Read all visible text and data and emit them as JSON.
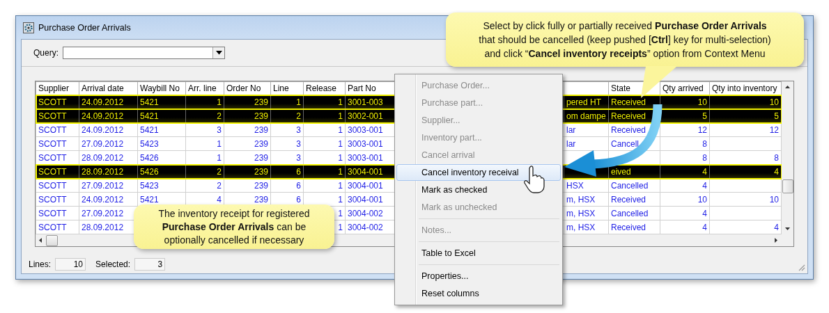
{
  "window": {
    "title": "Purchase Order Arrivals"
  },
  "query": {
    "label": "Query:"
  },
  "table": {
    "columns": [
      "Supplier",
      "Arrival date",
      "Waybill No",
      "Arr. line",
      "Order No",
      "Line",
      "Release",
      "Part No",
      "State",
      "Qty arrived",
      "Qty into inventory"
    ],
    "rows": [
      {
        "supplier": "SCOTT",
        "arrival_date": "24.09.2012",
        "waybill_no": "5421",
        "arr_line": "1",
        "order_no": "239",
        "line": "1",
        "release": "1",
        "part_no": "3001-003",
        "column_9": "pered HT",
        "state": "Received",
        "qty_arrived": "10",
        "qty_into_inventory": "10",
        "selected": true
      },
      {
        "supplier": "SCOTT",
        "arrival_date": "24.09.2012",
        "waybill_no": "5421",
        "arr_line": "2",
        "order_no": "239",
        "line": "2",
        "release": "1",
        "part_no": "3002-001",
        "column_9": "om dampe",
        "state": "Received",
        "qty_arrived": "5",
        "qty_into_inventory": "5",
        "selected": true
      },
      {
        "supplier": "SCOTT",
        "arrival_date": "24.09.2012",
        "waybill_no": "5421",
        "arr_line": "3",
        "order_no": "239",
        "line": "3",
        "release": "1",
        "part_no": "3003-001",
        "column_9": "lar",
        "state": "Received",
        "qty_arrived": "12",
        "qty_into_inventory": "12",
        "selected": false
      },
      {
        "supplier": "SCOTT",
        "arrival_date": "27.09.2012",
        "waybill_no": "5423",
        "arr_line": "1",
        "order_no": "239",
        "line": "3",
        "release": "1",
        "part_no": "3003-001",
        "column_9": "lar",
        "state": "Cancell",
        "qty_arrived": "8",
        "selected": false
      },
      {
        "supplier": "SCOTT",
        "arrival_date": "28.09.2012",
        "waybill_no": "5426",
        "arr_line": "1",
        "order_no": "239",
        "line": "3",
        "release": "1",
        "part_no": "3003-001",
        "qty_arrived": "8",
        "qty_into_inventory": "8",
        "selected": false
      },
      {
        "supplier": "SCOTT",
        "arrival_date": "28.09.2012",
        "waybill_no": "5426",
        "arr_line": "2",
        "order_no": "239",
        "line": "6",
        "release": "1",
        "part_no": "3004-001",
        "state": "eived",
        "qty_arrived": "4",
        "qty_into_inventory": "4",
        "selected": true
      },
      {
        "supplier": "SCOTT",
        "arrival_date": "27.09.2012",
        "waybill_no": "5423",
        "arr_line": "2",
        "order_no": "239",
        "line": "6",
        "release": "1",
        "part_no": "3004-001",
        "column_9": "HSX",
        "state": "Cancelled",
        "qty_arrived": "4",
        "selected": false
      },
      {
        "supplier": "SCOTT",
        "arrival_date": "24.09.2012",
        "waybill_no": "5421",
        "arr_line": "4",
        "order_no": "239",
        "line": "6",
        "release": "1",
        "part_no": "3004-001",
        "column_9": "m, HSX",
        "state": "Received",
        "qty_arrived": "10",
        "qty_into_inventory": "10",
        "selected": false
      },
      {
        "supplier": "SCOTT",
        "arrival_date": "27.09.2012",
        "release": "1",
        "part_no": "3004-002",
        "column_9": "m, HSX",
        "state": "Cancelled",
        "qty_arrived": "4",
        "selected": false
      },
      {
        "supplier": "SCOTT",
        "arrival_date": "28.09.2012",
        "release": "1",
        "part_no": "3004-002",
        "column_9": "m, HSX",
        "state": "Received",
        "qty_arrived": "4",
        "qty_into_inventory": "4",
        "selected": false
      }
    ]
  },
  "status_bar": {
    "lines_label": "Lines:",
    "lines": "10",
    "selected_label": "Selected:",
    "selected_count": "3"
  },
  "context_menu": [
    {
      "kind": "item",
      "label": "Purchase Order...",
      "disabled": true,
      "selected": false
    },
    {
      "kind": "item",
      "label": "Purchase part...",
      "disabled": true,
      "selected": false
    },
    {
      "kind": "item",
      "label": "Supplier...",
      "disabled": true,
      "selected": false
    },
    {
      "kind": "item",
      "label": "Inventory part...",
      "disabled": true,
      "selected": false
    },
    {
      "kind": "item",
      "label": "Cancel arrival",
      "disabled": true,
      "selected": false
    },
    {
      "kind": "item",
      "label": "Cancel inventory receival",
      "disabled": false,
      "selected": true
    },
    {
      "kind": "item",
      "label": "Mark as checked",
      "disabled": false,
      "selected": false
    },
    {
      "kind": "item",
      "label": "Mark as unchecked",
      "disabled": true,
      "selected": false
    },
    {
      "kind": "separator"
    },
    {
      "kind": "item",
      "label": "Notes...",
      "disabled": true,
      "selected": false
    },
    {
      "kind": "separator"
    },
    {
      "kind": "item",
      "label": "Table to Excel",
      "disabled": false,
      "selected": false
    },
    {
      "kind": "separator"
    },
    {
      "kind": "item",
      "label": "Properties...",
      "disabled": false,
      "selected": false
    },
    {
      "kind": "item",
      "label": "Reset columns",
      "disabled": false,
      "selected": false
    }
  ],
  "callouts": [
    {
      "lines": [
        "Select by click fully or partially received **Purchase Order Arrivals**",
        "that should be cancelled (keep pushed [**Ctrl**] key for multi-selection)",
        "and click “**Cancel inventory receipts**” option from Context Menu"
      ]
    },
    {
      "lines": [
        "The inventory receipt for registered",
        "**Purchase Order Arrivals** can be",
        "optionally cancelled if necessary"
      ]
    }
  ]
}
